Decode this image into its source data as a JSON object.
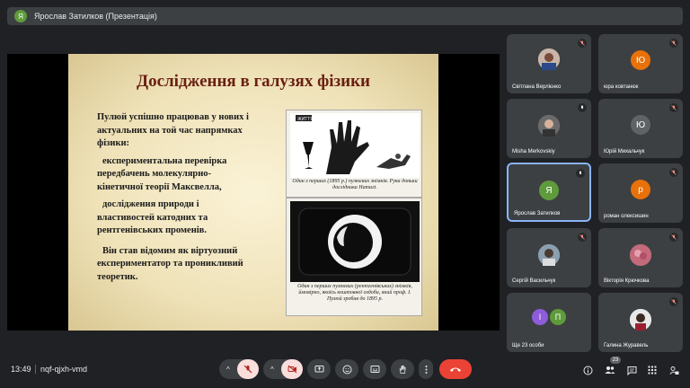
{
  "presenter_bar": {
    "avatar_letter": "Я",
    "title": "Ярослав Затилков (Презентація)"
  },
  "slide": {
    "title": "Дослідження в галузях фізики",
    "paragraphs": [
      "Пулюй успішно працював у нових і актуальних на той час напрямках фізики:",
      "експериментальна перевірка передбачень молекулярно-кінетичної теорії Максвелла,",
      "дослідження природи і властивостей катодних та рентгенівських променів.",
      "Він став відомим як віртуозний експериментатор та проникливий теоретик."
    ],
    "figure1_label": "ЖИТТЯ",
    "figure1_caption": "Один з перших (1895 р.) пулюєвих знімків. Рука доньки дослідника Наталі.",
    "figure2_caption": "Один з перших пулюєвих (рентгенівських) знімків, ймовірно, якоїсь коштовної оздоби, який проф. І. Пулюй зробив до 1895 р."
  },
  "participants": [
    {
      "name": "Світлана Верлієнко",
      "type": "photo",
      "muted": true
    },
    {
      "name": "юра ковтанюк",
      "type": "letter",
      "letter": "Ю",
      "color": "#e8710a",
      "muted": true
    },
    {
      "name": "Misha Merkovskiy",
      "type": "photo",
      "muted": false
    },
    {
      "name": "Юрій Михальчук",
      "type": "letter",
      "letter": "Ю",
      "color": "#5f6368",
      "muted": true
    },
    {
      "name": "Ярослав Затилков",
      "type": "letter",
      "letter": "Я",
      "color": "#5f9b3b",
      "muted": false,
      "active": true
    },
    {
      "name": "роман олексишин",
      "type": "letter",
      "letter": "р",
      "color": "#e8710a",
      "muted": true
    },
    {
      "name": "Сергій Васильчук",
      "type": "photo",
      "muted": true
    },
    {
      "name": "Вікторія Крючкова",
      "type": "photo",
      "muted": true
    },
    {
      "name": "Ще 23 особи",
      "type": "group",
      "letters": [
        "І",
        "П"
      ]
    },
    {
      "name": "Галина Журавель",
      "type": "photo",
      "muted": true
    }
  ],
  "bottom_bar": {
    "time": "13:49",
    "meeting_code": "nqf-qjxh-vmd",
    "participant_count": "23"
  },
  "colors": {
    "background": "#202124",
    "tile": "#3c4043",
    "danger": "#ea4335",
    "active_border": "#8ab4f8"
  }
}
